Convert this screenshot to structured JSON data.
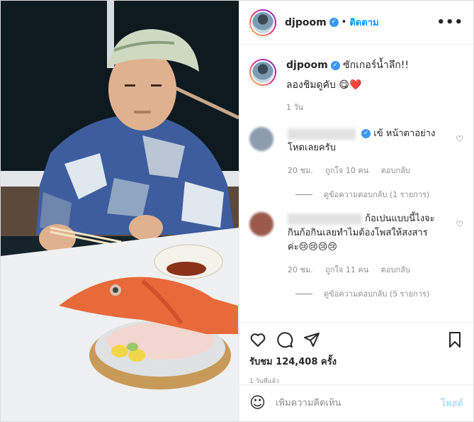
{
  "header": {
    "username": "djpoom",
    "follow_label": "ติดตาม",
    "more_label": "•••"
  },
  "caption": {
    "username": "djpoom",
    "text": "ซักเกอร์น้ำลึก!!",
    "line2": "ลองชิมดูคับ 😋❤️",
    "time": "1 วัน"
  },
  "comments": [
    {
      "text_line1": "เข้ หน้าตาอย่าง",
      "text_line2": "โหดเลยครับ",
      "text_line3": "",
      "time": "20 ชม.",
      "likes": "ถูกใจ 10 คน",
      "reply_label": "ตอบกลับ",
      "view_replies": "ดูข้อความตอบกลับ (1 รายการ)",
      "verified": true
    },
    {
      "text_line1": "ก้อเปนแบบนี้ไงจะ",
      "text_line2": "กินก้อกินเลยทำไมต้องโพสให้สงสาร",
      "text_line3": "ค่ะ😢😢😢😢",
      "time": "20 ชม.",
      "likes": "ถูกใจ 11 คน",
      "reply_label": "ตอบกลับ",
      "view_replies": "ดูข้อความตอบกลับ (5 รายการ)",
      "verified": false
    }
  ],
  "stats": {
    "views": "รับชม 124,408 ครั้ง",
    "age": "1 วันที่แล้ว"
  },
  "add_comment": {
    "placeholder": "เพิ่มความคิดเห็น",
    "post_label": "โพสต์"
  },
  "icons": [
    "heart-icon",
    "comment-icon",
    "share-icon",
    "bookmark-icon",
    "emoji-icon",
    "verified-icon"
  ],
  "colors": {
    "accent": "#0095f6",
    "verified": "#3897f0",
    "muted": "#8e8e8e"
  }
}
